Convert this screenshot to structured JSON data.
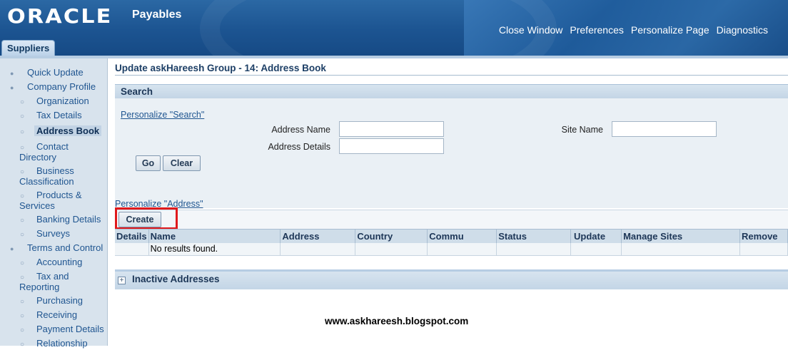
{
  "header": {
    "logo": "ORACLE",
    "product": "Payables",
    "global_links": [
      "Close Window",
      "Preferences",
      "Personalize Page",
      "Diagnostics"
    ],
    "tab": "Suppliers"
  },
  "sidebar": {
    "items": [
      {
        "label": "Quick Update"
      },
      {
        "label": "Company Profile"
      },
      {
        "label": "Organization"
      },
      {
        "label": "Tax Details"
      },
      {
        "label": "Address Book"
      },
      {
        "label": "Contact Directory"
      },
      {
        "label": "Business Classification"
      },
      {
        "label": "Products & Services"
      },
      {
        "label": "Banking Details"
      },
      {
        "label": "Surveys"
      },
      {
        "label": "Terms and Control"
      },
      {
        "label": "Accounting"
      },
      {
        "label": "Tax and Reporting"
      },
      {
        "label": "Purchasing"
      },
      {
        "label": "Receiving"
      },
      {
        "label": "Payment Details"
      },
      {
        "label": "Relationship"
      }
    ]
  },
  "main": {
    "title": "Update askHareesh Group - 14: Address Book",
    "search": {
      "header": "Search",
      "personalize_link": "Personalize \"Search\"",
      "address_name_label": "Address Name",
      "address_details_label": "Address Details",
      "site_name_label": "Site Name",
      "address_name_value": "",
      "address_details_value": "",
      "site_name_value": "",
      "go_label": "Go",
      "clear_label": "Clear"
    },
    "address": {
      "personalize_link": "Personalize \"Address\"",
      "create_label": "Create",
      "columns": [
        "Details",
        "Name",
        "Address",
        "Country",
        "Commu",
        "Status",
        "Update",
        "Manage Sites",
        "Remove"
      ],
      "empty_message": "No results found."
    },
    "inactive": {
      "header": "Inactive Addresses"
    }
  },
  "watermark": "www.askhareesh.blogspot.com",
  "colors": {
    "header_blue": "#1c5491",
    "link_blue": "#1f5590",
    "highlight_red": "#e0191c",
    "sidebar_bg": "#d8e3ed"
  }
}
